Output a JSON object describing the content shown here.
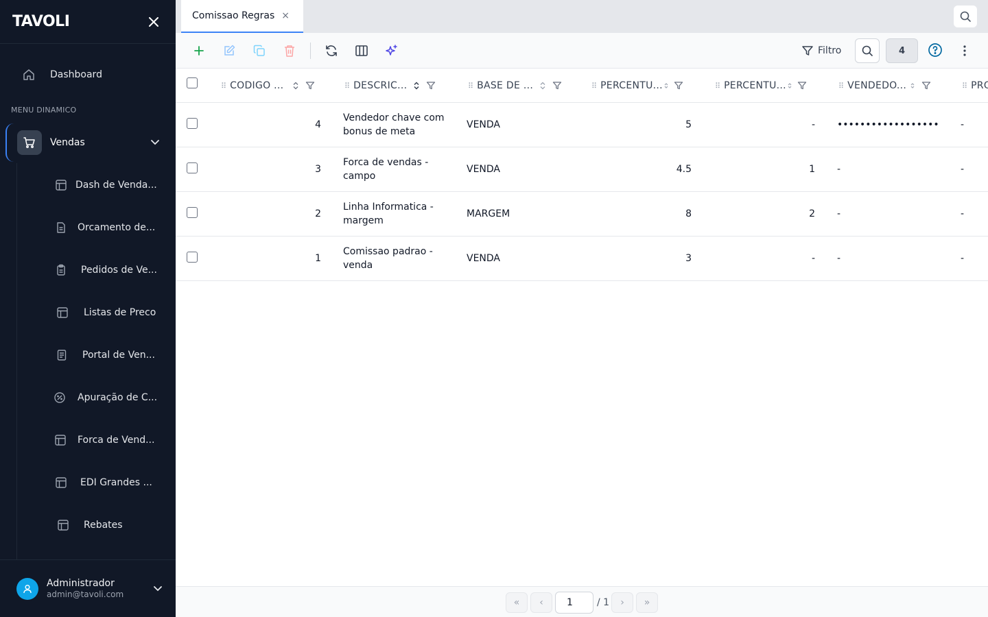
{
  "sidebar": {
    "logo": "TAVOLI",
    "dashboard_label": "Dashboard",
    "menu_title": "MENU DINAMICO",
    "vendas_label": "Vendas",
    "submenu": [
      {
        "label": "Dash de Venda...",
        "icon": "table-icon"
      },
      {
        "label": "Orcamento de...",
        "icon": "document-icon"
      },
      {
        "label": "Pedidos de Ve...",
        "icon": "clipboard-icon"
      },
      {
        "label": "Listas de Preco",
        "icon": "table-icon"
      },
      {
        "label": "Portal de Ven...",
        "icon": "document-lines-icon"
      },
      {
        "label": "Apuração de C...",
        "icon": "percent-circle-icon"
      },
      {
        "label": "Forca de Vend...",
        "icon": "table-icon"
      },
      {
        "label": "EDI Grandes ...",
        "icon": "table-icon"
      },
      {
        "label": "Rebates",
        "icon": "table-icon"
      }
    ],
    "user": {
      "name": "Administrador",
      "email": "admin@tavoli.com"
    }
  },
  "tabs": [
    {
      "label": "Comissao Regras",
      "close": "×"
    }
  ],
  "toolbar": {
    "filter_label": "Filtro",
    "count": "4"
  },
  "table": {
    "columns": [
      {
        "label": "CODIGO ..."
      },
      {
        "label": "DESCRIC..."
      },
      {
        "label": "BASE DE ..."
      },
      {
        "label": "PERCENTU..."
      },
      {
        "label": "PERCENTU..."
      },
      {
        "label": "VENDEDO..."
      },
      {
        "label": "PRO"
      }
    ],
    "rows": [
      {
        "codigo": "4",
        "desc1": "Vendedor chave com",
        "desc2": "bonus de meta",
        "base": "VENDA",
        "perc1": "5",
        "perc2": "-",
        "vendedor": "••••••••••••••••••",
        "pro": "-"
      },
      {
        "codigo": "3",
        "desc1": "Forca de vendas -",
        "desc2": "campo",
        "base": "VENDA",
        "perc1": "4.5",
        "perc2": "1",
        "vendedor": "-",
        "pro": "-"
      },
      {
        "codigo": "2",
        "desc1": "Linha Informatica -",
        "desc2": "margem",
        "base": "MARGEM",
        "perc1": "8",
        "perc2": "2",
        "vendedor": "-",
        "pro": "-"
      },
      {
        "codigo": "1",
        "desc1": "Comissao padrao -",
        "desc2": "venda",
        "base": "VENDA",
        "perc1": "3",
        "perc2": "-",
        "vendedor": "-",
        "pro": "-"
      }
    ]
  },
  "pagination": {
    "first": "«",
    "prev": "‹",
    "page": "1",
    "total": "/ 1",
    "next": "›",
    "last": "»"
  },
  "colors": {
    "sidebar_bg": "#111827",
    "accent": "#3b82f6",
    "add": "#16a34a",
    "delete": "#ef4444",
    "ai": "#4f46e5",
    "avatar": "#0ea5e9",
    "help": "#0369a1"
  }
}
